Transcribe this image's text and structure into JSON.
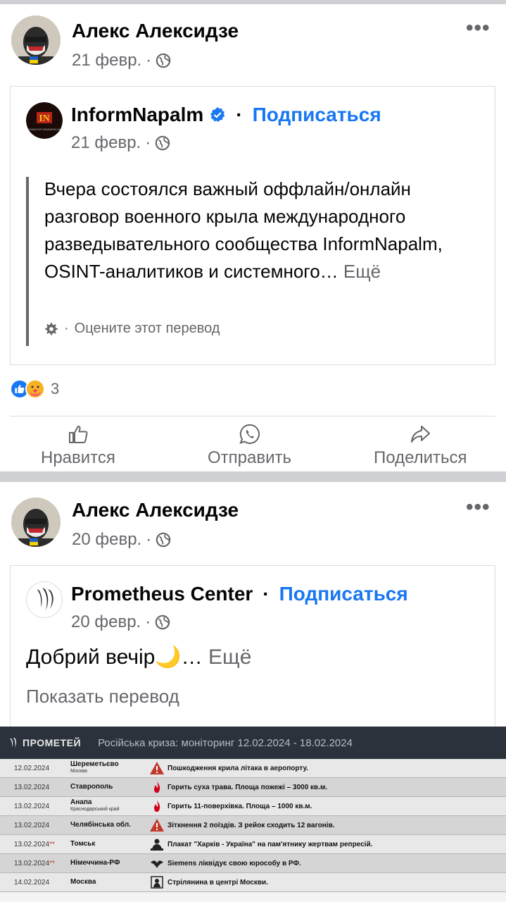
{
  "post1": {
    "author": "Алекс Алексидзе",
    "date": "21 февр.",
    "meta_sep": "·",
    "more": "•••",
    "shared": {
      "page_name": "InformNapalm",
      "verified": true,
      "separator": "·",
      "follow_label": "Подписаться",
      "date": "21 февр.",
      "text": "Вчера состоялся важный оффлайн/онлайн разговор военного крыла международного разведывательного сообщества InformNapalm, OSINT-аналитиков и системного…",
      "see_more": "Ещё",
      "rate_sep": "·",
      "rate_translation": "Оцените этот перевод"
    },
    "reactions": {
      "types": [
        "like",
        "care"
      ],
      "count": "3"
    },
    "actions": {
      "like": "Нравится",
      "send": "Отправить",
      "share": "Поделиться"
    }
  },
  "post2": {
    "author": "Алекс Алексидзе",
    "date": "20 февр.",
    "meta_sep": "·",
    "more": "•••",
    "shared": {
      "page_name": "Prometheus Center",
      "separator": "·",
      "follow_label": "Подписаться",
      "date": "20 февр.",
      "text": "Добрий вечір🌙…",
      "see_more": "Ещё",
      "show_translation": "Показать перевод"
    }
  },
  "monitoring": {
    "logo": "ПРОМЕТЕЙ",
    "title": "Російська криза: моніторинг 12.02.2024 - 18.02.2024",
    "rows": [
      {
        "date": "12.02.2024",
        "star": "",
        "city": "Шереметьєво",
        "region": "Москва",
        "icon": "warning",
        "event": "Пошкодження крила літака в аеропорту."
      },
      {
        "date": "13.02.2024",
        "star": "",
        "city": "Ставрополь",
        "region": "",
        "icon": "fire",
        "event": "Горить суха трава. Площа пожежі – 3000 кв.м."
      },
      {
        "date": "13.02.2024",
        "star": "",
        "city": "Анапа",
        "region": "Краснодарський край",
        "icon": "fire",
        "event": "Горить 11-поверхівка. Площа – 1000 кв.м."
      },
      {
        "date": "13.02.2024",
        "star": "",
        "city": "Челябінська обл.",
        "region": "",
        "icon": "warning",
        "event": "Зіткнення 2 поїздів. З рейок сходить 12 вагонів."
      },
      {
        "date": "13.02.2024",
        "star": "**",
        "city": "Томськ",
        "region": "",
        "icon": "person",
        "event": "Плакат \"Харків - Україна\" на пам'ятнику жертвам репресій."
      },
      {
        "date": "13.02.2024",
        "star": "**",
        "city": "Німеччина-РФ",
        "region": "",
        "icon": "bird",
        "event": "Siemens ліквідує свою юрособу в РФ."
      },
      {
        "date": "14.02.2024",
        "star": "",
        "city": "Москва",
        "region": "",
        "icon": "gun",
        "event": "Стрілянина в центрі Москви."
      }
    ]
  },
  "colors": {
    "link_blue": "#1877f2",
    "secondary_text": "#65676b",
    "separator_gray": "#ced0d4",
    "monitor_header": "#2b323b",
    "alert_red": "#c0392b"
  }
}
